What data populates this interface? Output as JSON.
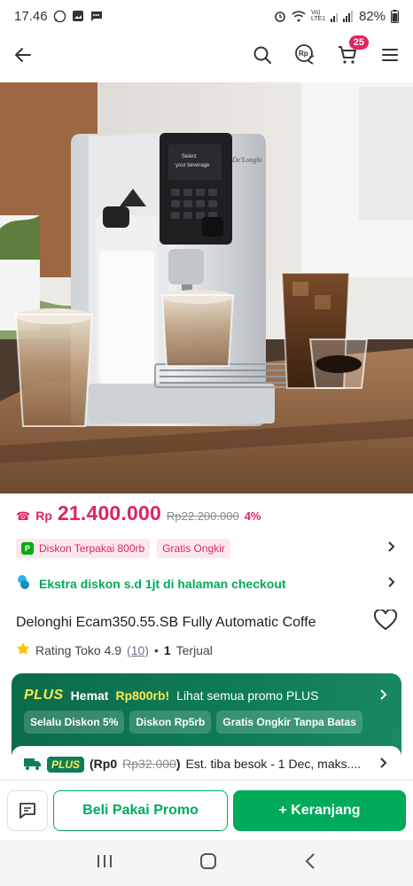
{
  "status_bar": {
    "time": "17.46",
    "battery": "82%",
    "lte_label": "Vo) LTE1"
  },
  "topbar": {
    "cart_count": "25",
    "icons": [
      "back-arrow-icon",
      "search-icon",
      "promo-chat-icon",
      "cart-icon",
      "menu-icon"
    ]
  },
  "hero": {
    "screen_text_1": "Select",
    "screen_text_2": "your beverage",
    "brand_text": "De'Longhi"
  },
  "price": {
    "currency": "Rp",
    "current": "21.400.000",
    "original": "Rp22.200.000",
    "discount": "4%"
  },
  "promo": {
    "chip_1": "Diskon Terpakai 800rb",
    "chip_2": "Gratis Ongkir",
    "extra_discount": "Ekstra diskon s.d 1jt di halaman checkout"
  },
  "product": {
    "title": "Delonghi Ecam350.55.SB Fully Automatic Coffe",
    "rating_label": "Rating Toko 4.9",
    "rating_count": "(10)",
    "sold_prefix": "•",
    "sold_count": "1",
    "sold_label": "Terjual"
  },
  "plus": {
    "logo": "PLUS",
    "hemat_label": "Hemat",
    "amount": "Rp800rb!",
    "rest": "Lihat semua promo PLUS",
    "chips": [
      "Selalu Diskon 5%",
      "Diskon Rp5rb",
      "Gratis Ongkir Tanpa Batas"
    ],
    "ship_logo": "PLUS",
    "ship_open": "(Rp0",
    "ship_old": "Rp32.000",
    "ship_close": ")",
    "ship_eta": "Est. tiba besok - 1 Dec, maks...."
  },
  "bottom": {
    "buy_label": "Beli Pakai Promo",
    "cart_label": "+ Keranjang"
  },
  "colors": {
    "accent": "#00aa5b",
    "price": "#e0245e",
    "plus_bg": "#0f7d57",
    "plus_yellow": "#ffe94d"
  }
}
